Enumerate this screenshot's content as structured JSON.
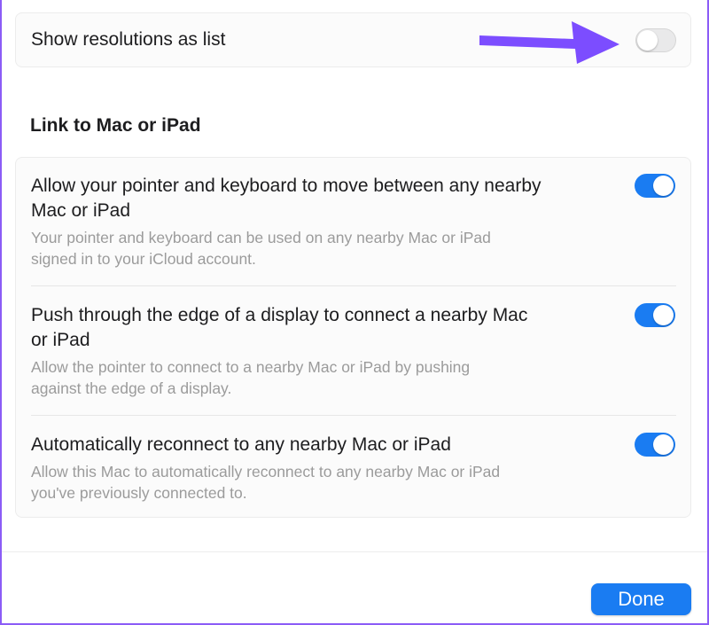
{
  "display": {
    "show_resolutions_label": "Show resolutions as list",
    "show_resolutions_on": false
  },
  "link_section": {
    "title": "Link to Mac or iPad",
    "items": [
      {
        "title_line1": "Allow your pointer and keyboard to move between any nearby",
        "title_line2": "Mac or iPad",
        "desc_line1": "Your pointer and keyboard can be used on any nearby Mac or iPad",
        "desc_line2": "signed in to your iCloud account.",
        "on": true
      },
      {
        "title_line1": "Push through the edge of a display to connect a nearby Mac",
        "title_line2": "or iPad",
        "desc_line1": "Allow the pointer to connect to a nearby Mac or iPad by pushing",
        "desc_line2": "against the edge of a display.",
        "on": true
      },
      {
        "title_line1": "Automatically reconnect to any nearby Mac or iPad",
        "desc_line1": "Allow this Mac to automatically reconnect to any nearby Mac or iPad",
        "desc_line2": "you've previously connected to.",
        "on": true
      }
    ]
  },
  "footer": {
    "done_label": "Done"
  },
  "colors": {
    "accent": "#1a7cf2",
    "annotation_arrow": "#7c4dff"
  },
  "icons": {
    "annotation": "arrow-right-icon"
  }
}
